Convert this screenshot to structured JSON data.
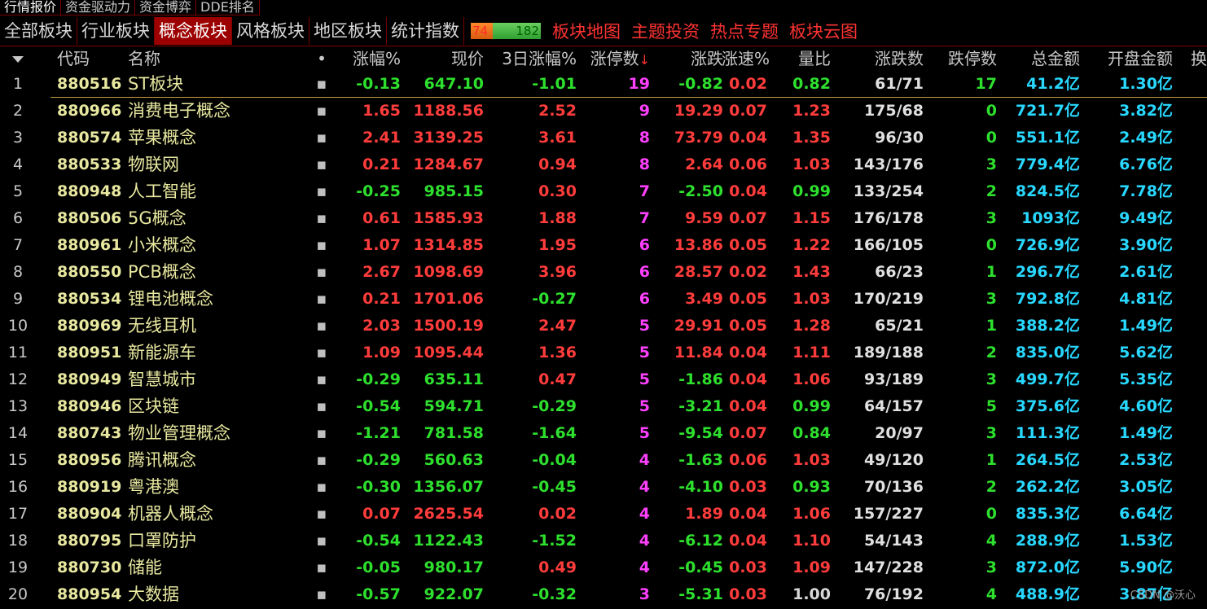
{
  "top_tabs": [
    {
      "label": "行情报价",
      "active": true
    },
    {
      "label": "资金驱动力",
      "active": false
    },
    {
      "label": "资金博弈",
      "active": false
    },
    {
      "label": "DDE排名",
      "active": false
    }
  ],
  "sub_tabs": [
    {
      "label": "全部板块",
      "active": false
    },
    {
      "label": "行业板块",
      "active": false
    },
    {
      "label": "概念板块",
      "active": true
    },
    {
      "label": "风格板块",
      "active": false
    },
    {
      "label": "地区板块",
      "active": false
    },
    {
      "label": "统计指数",
      "active": false
    }
  ],
  "ratio": {
    "up": "74",
    "down": "182"
  },
  "links": [
    "板块地图",
    "主题投资",
    "热点专题",
    "板块云图"
  ],
  "headers": {
    "code": "代码",
    "name": "名称",
    "dot": "•",
    "chg": "涨幅%",
    "price": "现价",
    "chg3": "3日涨幅%",
    "lim": "涨停数",
    "zd": "涨跌",
    "spd": "涨速%",
    "lb": "量比",
    "ud": "涨跌数",
    "dl": "跌停数",
    "amt": "总金额",
    "open": "开盘金额",
    "more": "换"
  },
  "rows": [
    {
      "idx": "1",
      "code": "880516",
      "name": "ST板块",
      "chg": "-0.13",
      "price": "647.10",
      "chg3": "-1.01",
      "lim": "19",
      "zd": "-0.82",
      "spd": "0.02",
      "lb": "0.82",
      "ud": "61/71",
      "dl": "17",
      "amt": "41.2亿",
      "open": "1.30亿"
    },
    {
      "idx": "2",
      "code": "880966",
      "name": "消费电子概念",
      "chg": "1.65",
      "price": "1188.56",
      "chg3": "2.52",
      "lim": "9",
      "zd": "19.29",
      "spd": "0.07",
      "lb": "1.23",
      "ud": "175/68",
      "dl": "0",
      "amt": "721.7亿",
      "open": "3.82亿"
    },
    {
      "idx": "3",
      "code": "880574",
      "name": "苹果概念",
      "chg": "2.41",
      "price": "3139.25",
      "chg3": "3.61",
      "lim": "8",
      "zd": "73.79",
      "spd": "0.04",
      "lb": "1.35",
      "ud": "96/30",
      "dl": "0",
      "amt": "551.1亿",
      "open": "2.49亿"
    },
    {
      "idx": "4",
      "code": "880533",
      "name": "物联网",
      "chg": "0.21",
      "price": "1284.67",
      "chg3": "0.94",
      "lim": "8",
      "zd": "2.64",
      "spd": "0.06",
      "lb": "1.03",
      "ud": "143/176",
      "dl": "3",
      "amt": "779.4亿",
      "open": "6.76亿"
    },
    {
      "idx": "5",
      "code": "880948",
      "name": "人工智能",
      "chg": "-0.25",
      "price": "985.15",
      "chg3": "0.30",
      "lim": "7",
      "zd": "-2.50",
      "spd": "0.04",
      "lb": "0.99",
      "ud": "133/254",
      "dl": "2",
      "amt": "824.5亿",
      "open": "7.78亿"
    },
    {
      "idx": "6",
      "code": "880506",
      "name": "5G概念",
      "chg": "0.61",
      "price": "1585.93",
      "chg3": "1.88",
      "lim": "7",
      "zd": "9.59",
      "spd": "0.07",
      "lb": "1.15",
      "ud": "176/178",
      "dl": "3",
      "amt": "1093亿",
      "open": "9.49亿"
    },
    {
      "idx": "7",
      "code": "880961",
      "name": "小米概念",
      "chg": "1.07",
      "price": "1314.85",
      "chg3": "1.95",
      "lim": "6",
      "zd": "13.86",
      "spd": "0.05",
      "lb": "1.22",
      "ud": "166/105",
      "dl": "0",
      "amt": "726.9亿",
      "open": "3.90亿"
    },
    {
      "idx": "8",
      "code": "880550",
      "name": "PCB概念",
      "chg": "2.67",
      "price": "1098.69",
      "chg3": "3.96",
      "lim": "6",
      "zd": "28.57",
      "spd": "0.02",
      "lb": "1.43",
      "ud": "66/23",
      "dl": "1",
      "amt": "296.7亿",
      "open": "2.61亿"
    },
    {
      "idx": "9",
      "code": "880534",
      "name": "锂电池概念",
      "chg": "0.21",
      "price": "1701.06",
      "chg3": "-0.27",
      "lim": "6",
      "zd": "3.49",
      "spd": "0.05",
      "lb": "1.03",
      "ud": "170/219",
      "dl": "3",
      "amt": "792.8亿",
      "open": "4.81亿"
    },
    {
      "idx": "10",
      "code": "880969",
      "name": "无线耳机",
      "chg": "2.03",
      "price": "1500.19",
      "chg3": "2.47",
      "lim": "5",
      "zd": "29.91",
      "spd": "0.05",
      "lb": "1.28",
      "ud": "65/21",
      "dl": "1",
      "amt": "388.2亿",
      "open": "1.49亿"
    },
    {
      "idx": "11",
      "code": "880951",
      "name": "新能源车",
      "chg": "1.09",
      "price": "1095.44",
      "chg3": "1.36",
      "lim": "5",
      "zd": "11.84",
      "spd": "0.04",
      "lb": "1.11",
      "ud": "189/188",
      "dl": "2",
      "amt": "835.0亿",
      "open": "5.62亿"
    },
    {
      "idx": "12",
      "code": "880949",
      "name": "智慧城市",
      "chg": "-0.29",
      "price": "635.11",
      "chg3": "0.47",
      "lim": "5",
      "zd": "-1.86",
      "spd": "0.04",
      "lb": "1.06",
      "ud": "93/189",
      "dl": "3",
      "amt": "499.7亿",
      "open": "5.35亿"
    },
    {
      "idx": "13",
      "code": "880946",
      "name": "区块链",
      "chg": "-0.54",
      "price": "594.71",
      "chg3": "-0.29",
      "lim": "5",
      "zd": "-3.21",
      "spd": "0.04",
      "lb": "0.99",
      "ud": "64/157",
      "dl": "5",
      "amt": "375.6亿",
      "open": "4.60亿"
    },
    {
      "idx": "14",
      "code": "880743",
      "name": "物业管理概念",
      "chg": "-1.21",
      "price": "781.58",
      "chg3": "-1.64",
      "lim": "5",
      "zd": "-9.54",
      "spd": "0.07",
      "lb": "0.84",
      "ud": "20/97",
      "dl": "3",
      "amt": "111.3亿",
      "open": "1.49亿"
    },
    {
      "idx": "15",
      "code": "880956",
      "name": "腾讯概念",
      "chg": "-0.29",
      "price": "560.63",
      "chg3": "-0.04",
      "lim": "4",
      "zd": "-1.63",
      "spd": "0.06",
      "lb": "1.03",
      "ud": "49/120",
      "dl": "1",
      "amt": "264.5亿",
      "open": "2.53亿"
    },
    {
      "idx": "16",
      "code": "880919",
      "name": "粤港澳",
      "chg": "-0.30",
      "price": "1356.07",
      "chg3": "-0.45",
      "lim": "4",
      "zd": "-4.10",
      "spd": "0.03",
      "lb": "0.93",
      "ud": "70/136",
      "dl": "2",
      "amt": "262.2亿",
      "open": "3.05亿"
    },
    {
      "idx": "17",
      "code": "880904",
      "name": "机器人概念",
      "chg": "0.07",
      "price": "2625.54",
      "chg3": "0.02",
      "lim": "4",
      "zd": "1.89",
      "spd": "0.04",
      "lb": "1.06",
      "ud": "157/227",
      "dl": "0",
      "amt": "835.3亿",
      "open": "6.64亿"
    },
    {
      "idx": "18",
      "code": "880795",
      "name": "口罩防护",
      "chg": "-0.54",
      "price": "1122.43",
      "chg3": "-1.52",
      "lim": "4",
      "zd": "-6.12",
      "spd": "0.04",
      "lb": "1.10",
      "ud": "54/143",
      "dl": "4",
      "amt": "288.9亿",
      "open": "1.53亿"
    },
    {
      "idx": "19",
      "code": "880730",
      "name": "储能",
      "chg": "-0.05",
      "price": "980.17",
      "chg3": "0.49",
      "lim": "4",
      "zd": "-0.45",
      "spd": "0.03",
      "lb": "1.09",
      "ud": "147/228",
      "dl": "3",
      "amt": "872.0亿",
      "open": "5.90亿"
    },
    {
      "idx": "20",
      "code": "880954",
      "name": "大数据",
      "chg": "-0.57",
      "price": "922.07",
      "chg3": "-0.32",
      "lim": "3",
      "zd": "-5.31",
      "spd": "0.03",
      "lb": "1.00",
      "ud": "76/192",
      "dl": "4",
      "amt": "488.9亿",
      "open": "3.87亿"
    }
  ],
  "dot_marker": "▪",
  "watermark": "CSDN @沃心",
  "colors": {
    "up": "#ff3c3c",
    "down": "#2ee02e",
    "code": "#e8e8a0",
    "limit": "#ff40ff",
    "amount": "#28d8ff",
    "active_tab": "#9c0000",
    "divider": "#7a0000"
  }
}
